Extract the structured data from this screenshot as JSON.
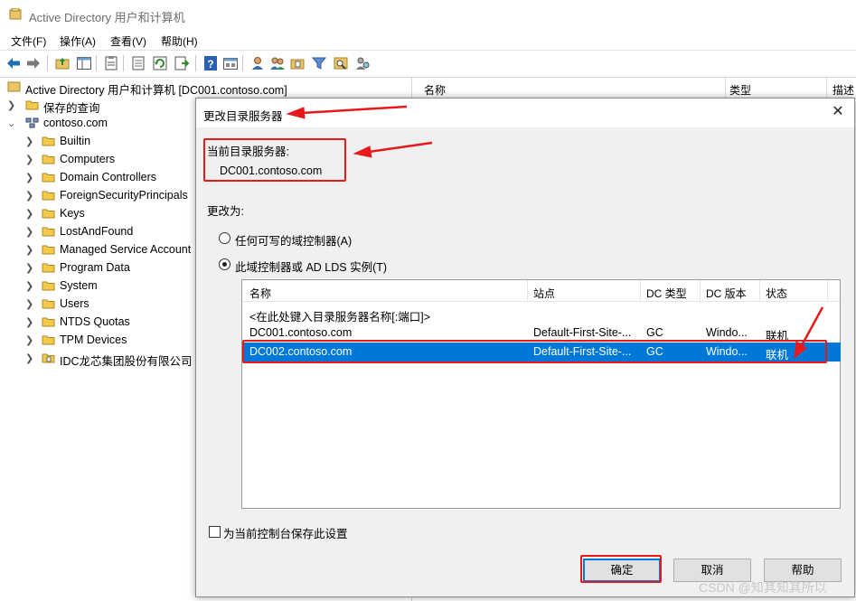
{
  "window": {
    "title": "Active Directory 用户和计算机"
  },
  "menu": [
    "文件(F)",
    "操作(A)",
    "查看(V)",
    "帮助(H)"
  ],
  "toolbar": {
    "icons": [
      "back-arrow-icon",
      "forward-arrow-icon",
      "up-folder-icon",
      "console-tree-icon",
      "properties-icon",
      "export-list-icon",
      "refresh-icon",
      "export-icon",
      "help-icon",
      "view-icon",
      "users-icon",
      "group-icon",
      "ou-icon",
      "filter-icon",
      "find-icon",
      "delegate-icon"
    ]
  },
  "tree": {
    "root": "Active Directory 用户和计算机 [DC001.contoso.com]",
    "saved_queries": "保存的查询",
    "domain": "contoso.com",
    "children": [
      "Builtin",
      "Computers",
      "Domain Controllers",
      "ForeignSecurityPrincipals",
      "Keys",
      "LostAndFound",
      "Managed Service Account",
      "Program Data",
      "System",
      "Users",
      "NTDS Quotas",
      "TPM Devices",
      "IDC龙芯集团股份有限公司"
    ]
  },
  "list": {
    "columns": [
      "名称",
      "类型",
      "描述"
    ]
  },
  "dialog": {
    "title": "更改目录服务器",
    "current_label": "当前目录服务器:",
    "current_value": "DC001.contoso.com",
    "change_to_label": "更改为:",
    "option_any": "任何可写的域控制器(A)",
    "option_this": "此域控制器或 AD LDS 实例(T)",
    "option_selected": "this",
    "table": {
      "columns": [
        "名称",
        "站点",
        "DC 类型",
        "DC 版本",
        "状态"
      ],
      "placeholder_row": "<在此处键入目录服务器名称[:端口]>",
      "rows": [
        {
          "name": "DC001.contoso.com",
          "site": "Default-First-Site-...",
          "dc_type": "GC",
          "dc_version": "Windo...",
          "status": "联机",
          "selected": false
        },
        {
          "name": "DC002.contoso.com",
          "site": "Default-First-Site-...",
          "dc_type": "GC",
          "dc_version": "Windo...",
          "status": "联机",
          "selected": true
        }
      ]
    },
    "save_setting_label": "为当前控制台保存此设置",
    "save_setting_checked": false,
    "buttons": {
      "ok": "确定",
      "cancel": "取消",
      "help": "帮助"
    }
  },
  "watermark": "CSDN @知其知其所以",
  "colors": {
    "selection": "#0078d7",
    "annotation": "#e8191b"
  }
}
